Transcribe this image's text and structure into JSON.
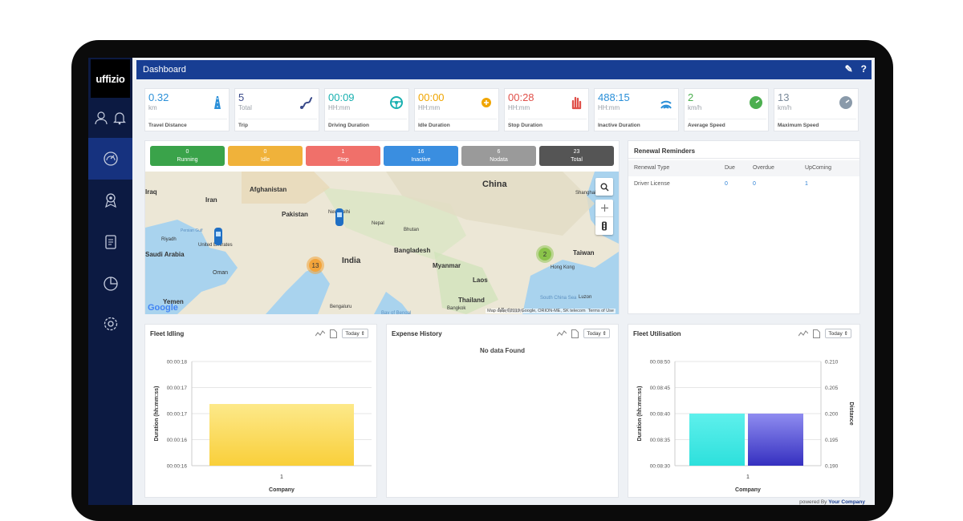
{
  "app": {
    "logo": "uffizio",
    "title": "Dashboard"
  },
  "sidebar": {
    "top_icons": [
      "user-icon",
      "bell-icon"
    ],
    "items": [
      {
        "icon": "gauge-icon",
        "active": true
      },
      {
        "icon": "location-badge-icon",
        "active": false
      },
      {
        "icon": "report-icon",
        "active": false
      },
      {
        "icon": "pie-chart-icon",
        "active": false
      },
      {
        "icon": "settings-icon",
        "active": false
      }
    ]
  },
  "stats": [
    {
      "value": "0.32",
      "unit": "km",
      "label": "Travel Distance",
      "color": "#2a8fd8",
      "icon": "road-icon"
    },
    {
      "value": "5",
      "unit": "Total",
      "label": "Trip",
      "color": "#3a4a8a",
      "icon": "route-icon"
    },
    {
      "value": "00:09",
      "unit": "HH:mm",
      "label": "Driving Duration",
      "color": "#19b0b0",
      "icon": "steering-wheel-icon"
    },
    {
      "value": "00:00",
      "unit": "HH:mm",
      "label": "Idle Duration",
      "color": "#f0a500",
      "icon": "idle-icon"
    },
    {
      "value": "00:28",
      "unit": "HH:mm",
      "label": "Stop Duration",
      "color": "#e0504a",
      "icon": "hand-icon"
    },
    {
      "value": "488:15",
      "unit": "HH:mm",
      "label": "Inactive Duration",
      "color": "#2a8fd8",
      "icon": "signal-icon"
    },
    {
      "value": "2",
      "unit": "km/h",
      "label": "Average Speed",
      "color": "#4caf50",
      "icon": "speedometer-icon"
    },
    {
      "value": "13",
      "unit": "km/h",
      "label": "Maximum Speed",
      "color": "#7a8a9a",
      "icon": "max-speed-icon"
    }
  ],
  "status_pills": [
    {
      "count": "0",
      "label": "Running",
      "color": "#3aa34a"
    },
    {
      "count": "0",
      "label": "Idle",
      "color": "#f0b23a"
    },
    {
      "count": "1",
      "label": "Stop",
      "color": "#f0706a"
    },
    {
      "count": "16",
      "label": "Inactive",
      "color": "#3a8ee0"
    },
    {
      "count": "6",
      "label": "Nodata",
      "color": "#9a9a9a"
    },
    {
      "count": "23",
      "label": "Total",
      "color": "#555555"
    }
  ],
  "map": {
    "labels": [
      "China",
      "Afghanistan",
      "Iran",
      "Pakistan",
      "New Delhi",
      "Nepal",
      "Bhutan",
      "Bangladesh",
      "India",
      "Myanmar",
      "Laos",
      "Thailand",
      "Vietnam",
      "Yemen",
      "Oman",
      "Riyadh",
      "Saudi Arabia",
      "United Emirates",
      "Persian Gulf",
      "Shanghai",
      "Taiwan",
      "Hong Kong",
      "Luzon",
      "South China Sea",
      "Bay of Bengal",
      "Bangkok",
      "Bengaluru",
      "Iraq"
    ],
    "clusters": [
      {
        "count": "13"
      },
      {
        "count": "2"
      }
    ],
    "attribution": "Map data ©2019 Google, ORION-ME, SK telecom",
    "terms": "Terms of Use",
    "google": "Google"
  },
  "reminders": {
    "title": "Renewal Reminders",
    "columns": [
      "Renewal Type",
      "Due",
      "Overdue",
      "UpComing"
    ],
    "rows": [
      [
        "Driver License",
        "0",
        "0",
        "1"
      ]
    ]
  },
  "panels": {
    "fleet_idling": {
      "title": "Fleet Idling",
      "period": "Today"
    },
    "expense_history": {
      "title": "Expense History",
      "period": "Today",
      "empty": "No data Found"
    },
    "fleet_utilisation": {
      "title": "Fleet Utilisation",
      "period": "Today"
    }
  },
  "chart_data": [
    {
      "type": "bar",
      "categories": [
        "1"
      ],
      "series": [
        {
          "values": [
            "00:00:17"
          ]
        }
      ],
      "xlabel": "Company",
      "ylabel": "Duration (hh:mm:ss)",
      "y_ticks": [
        "00:00:18",
        "00:00:17",
        "00:00:17",
        "00:00:16",
        "00:00:16"
      ],
      "color": "#f9cf3a"
    },
    {
      "type": "bar",
      "categories": [
        "1"
      ],
      "series": [
        {
          "values": [
            "00:08:40"
          ],
          "axis": "left"
        },
        {
          "values": [
            0.2
          ],
          "axis": "right"
        }
      ],
      "xlabel": "Company",
      "ylabel": "Duration (hh:mm:ss)",
      "y2label": "Distance",
      "y_ticks": [
        "00:08:50",
        "00:08:45",
        "00:08:40",
        "00:08:35",
        "00:08:30"
      ],
      "y2_ticks": [
        "0.210",
        "0.205",
        "0.200",
        "0.195",
        "0.190"
      ],
      "colors": [
        "#2de0dc",
        "#3530c0"
      ]
    }
  ],
  "footer": {
    "prefix": "powered By",
    "company": "Your Company"
  }
}
